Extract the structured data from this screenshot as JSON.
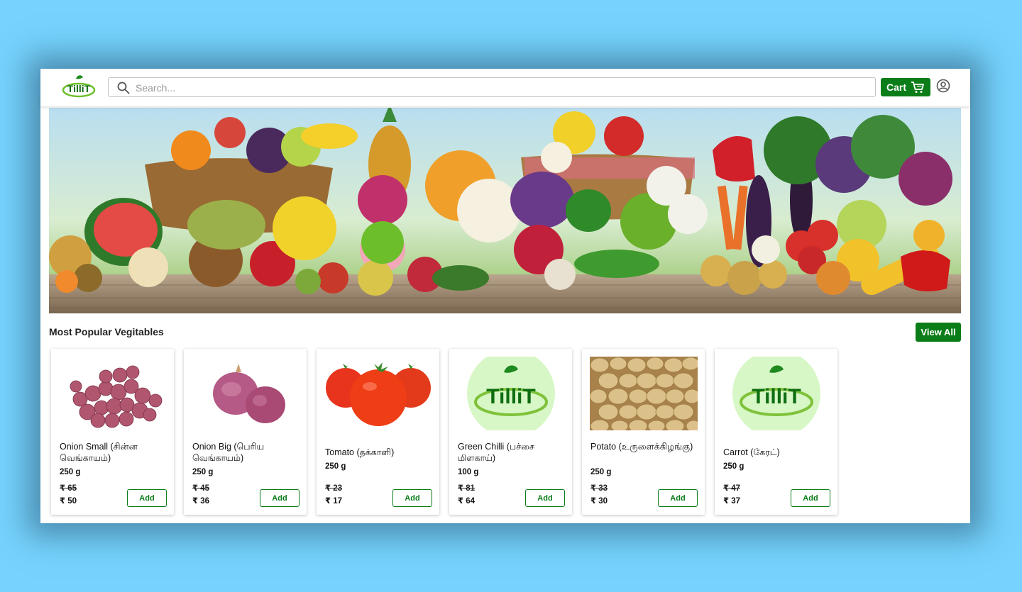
{
  "header": {
    "logo_text": "TilliT",
    "search_placeholder": "Search...",
    "cart_label": "Cart"
  },
  "section": {
    "title": "Most Popular Vegitables",
    "view_all_label": "View All"
  },
  "products": [
    {
      "name": "Onion Small (சின்ன வெங்காயம்)",
      "weight": "250 g",
      "mrp": "₹ 65",
      "price": "₹ 50",
      "add_label": "Add",
      "image": "small-onions"
    },
    {
      "name": "Onion Big (பெரிய வெங்காயம்)",
      "weight": "250 g",
      "mrp": "₹ 45",
      "price": "₹ 36",
      "add_label": "Add",
      "image": "big-onions"
    },
    {
      "name": "Tomato (தக்காளி)",
      "weight": "250 g",
      "mrp": "₹ 23",
      "price": "₹ 17",
      "add_label": "Add",
      "image": "tomatoes"
    },
    {
      "name": "Green Chilli (பச்சை மிளகாய்)",
      "weight": "100 g",
      "mrp": "₹ 81",
      "price": "₹ 64",
      "add_label": "Add",
      "image": "tillit-logo"
    },
    {
      "name": "Potato (உருளைக்கிழங்கு)",
      "weight": "250 g",
      "mrp": "₹ 33",
      "price": "₹ 30",
      "add_label": "Add",
      "image": "potatoes"
    },
    {
      "name": "Carrot (கேரட்)",
      "weight": "250 g",
      "mrp": "₹ 47",
      "price": "₹ 37",
      "add_label": "Add",
      "image": "tillit-logo"
    }
  ],
  "colors": {
    "brand_green": "#0a7d18",
    "page_background": "#75d3fd"
  }
}
